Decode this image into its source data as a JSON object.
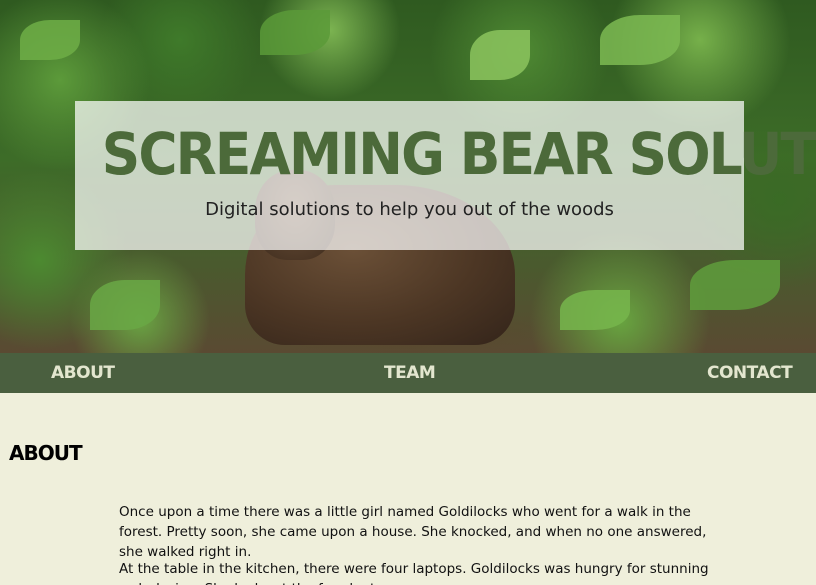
{
  "hero": {
    "title": "SCREAMING BEAR SOLUTIONS",
    "tagline": "Digital solutions to help you out of the woods"
  },
  "nav": {
    "items": [
      {
        "label": "ABOUT"
      },
      {
        "label": "TEAM"
      },
      {
        "label": "CONTACT"
      }
    ]
  },
  "about": {
    "heading": "ABOUT",
    "paragraphs": [
      "Once upon a time there was a little girl named Goldilocks who went for a walk in the forest. Pretty soon, she came upon a house. She knocked, and when no one answered, she walked right in.",
      "At the table in the kitchen, there were four laptops. Goldilocks was hungry for stunning web design. She looks at the four laptops."
    ]
  },
  "colors": {
    "nav_bg": "#4a5f3f",
    "page_bg": "#efefdb",
    "title_text": "#4c6a3a"
  }
}
